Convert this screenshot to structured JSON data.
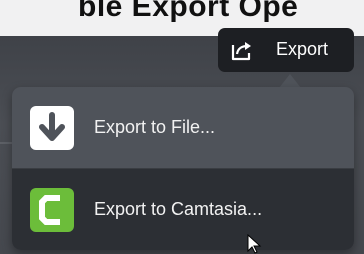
{
  "top_band": {
    "text": "ble Export Ope"
  },
  "toolbar": {
    "export_label": "Export",
    "export_icon": "share-export-icon"
  },
  "export_menu": {
    "items": [
      {
        "label": "Export to File...",
        "icon": "download-arrow-icon",
        "icon_color": "#ffffff"
      },
      {
        "label": "Export to Camtasia...",
        "icon": "camtasia-logo-icon",
        "icon_color": "#6cbd3a"
      }
    ],
    "highlighted_index": 1
  },
  "colors": {
    "menu_bg": "#4f535a",
    "menu_hover": "#2c2f34",
    "button_bg": "#1d1f23",
    "camtasia_green": "#6cbd3a"
  }
}
